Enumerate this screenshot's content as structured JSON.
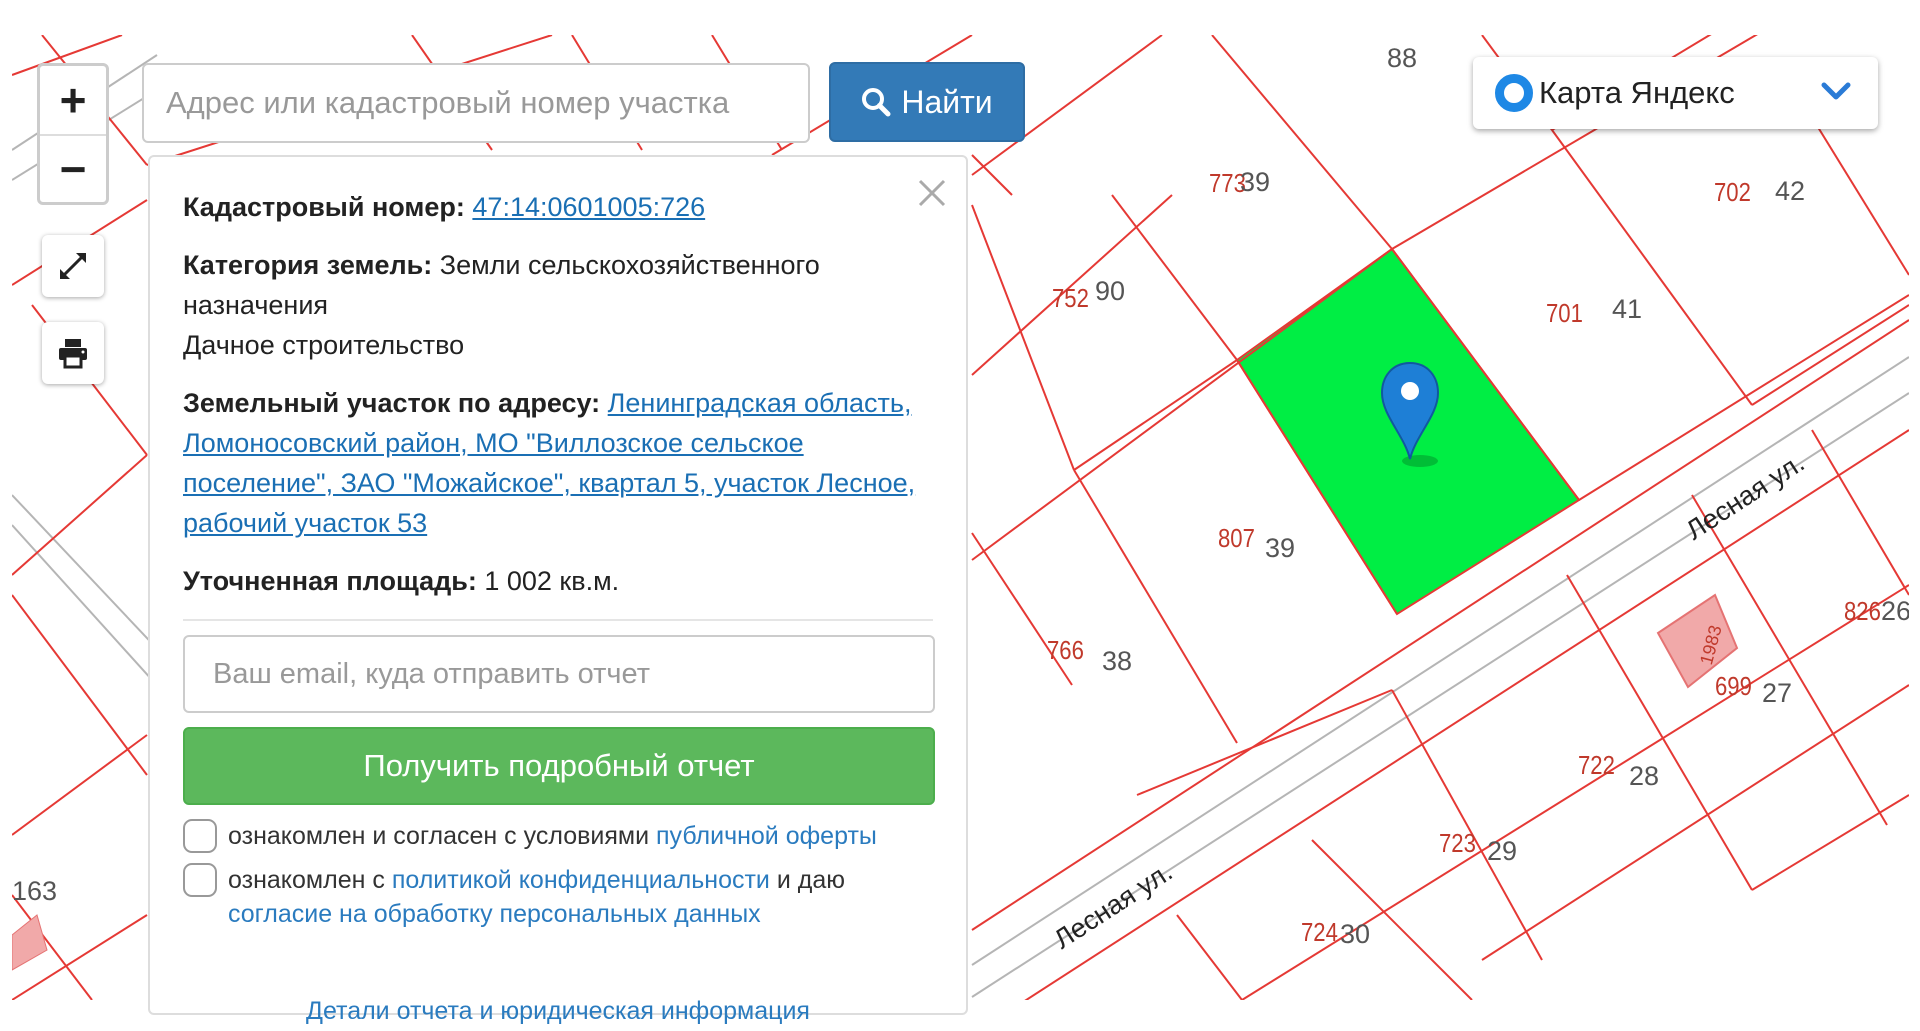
{
  "search": {
    "placeholder": "Адрес или кадастровый номер участка",
    "button_label": "Найти"
  },
  "zoom": {
    "in_label": "+",
    "out_label": "−"
  },
  "layer_select": {
    "selected": "Карта Яндекс"
  },
  "info": {
    "cadastral_label": "Кадастровый номер:",
    "cadastral_value": "47:14:0601005:726",
    "category_label": "Категория земель:",
    "category_value": "Земли сельскохозяйственного назначения",
    "usage": "Дачное строительство",
    "address_label": "Земельный участок по адресу:",
    "address_value": "Ленинградская область, Ломоносовский район, МО \"Виллозское сельское поселение\", ЗАО \"Можайское\", квартал 5, участок Лесное, рабочий участок 53",
    "area_label": "Уточненная площадь:",
    "area_value": "1 002 кв.м.",
    "email_placeholder": "Ваш email, куда отправить отчет",
    "report_button": "Получить подробный отчет",
    "consent1_text": "ознакомлен и согласен с условиями",
    "consent1_link": "публичной оферты",
    "consent2_text": "ознакомлен с",
    "consent2_link": "политикой конфиденциальности",
    "consent2_text2": "и даю",
    "consent2_link2": "согласие на обработку персональных данных",
    "details_link": "Детали отчета и юридическая информация"
  },
  "map": {
    "street_name": "Лесная ул.",
    "highlight_color": "#00ee44",
    "boundary_color": "#e53935",
    "plots": [
      {
        "num": "773",
        "house": "39"
      },
      {
        "num": "702",
        "house": "42"
      },
      {
        "num": "752",
        "house": "90"
      },
      {
        "num": "701",
        "house": "41"
      },
      {
        "num": "807",
        "house": "39"
      },
      {
        "num": "766",
        "house": "38"
      },
      {
        "num": "826",
        "house": "26"
      },
      {
        "num": "699",
        "house": "27"
      },
      {
        "num": "722",
        "house": "28"
      },
      {
        "num": "723",
        "house": "29"
      },
      {
        "num": "724",
        "house": "30"
      }
    ],
    "extra_labels": [
      "88",
      "163"
    ],
    "building_label": "1983"
  }
}
